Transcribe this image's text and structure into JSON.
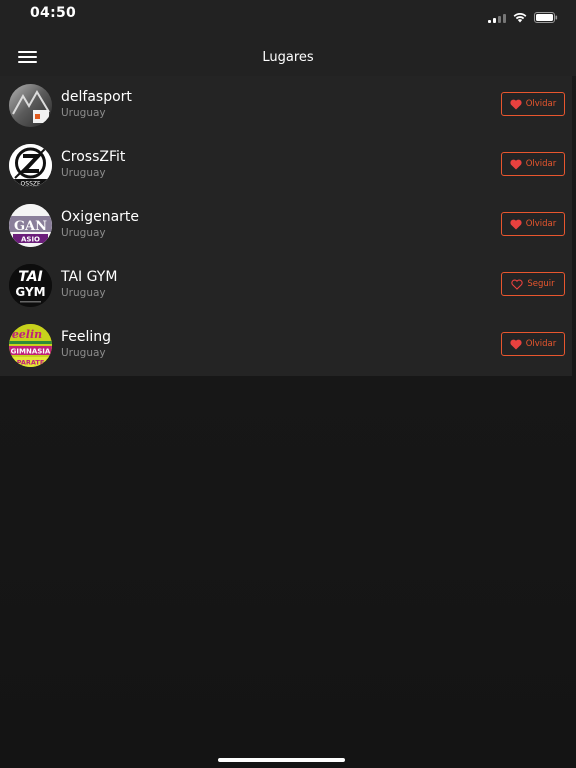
{
  "status_bar": {
    "time": "04:50"
  },
  "header": {
    "title": "Lugares"
  },
  "places": [
    {
      "name": "delfasport",
      "location": "Uruguay",
      "action": "Olvidar",
      "followed": true,
      "avatar": "delfasport-logo"
    },
    {
      "name": "CrossZFit",
      "location": "Uruguay",
      "action": "Olvidar",
      "followed": true,
      "avatar": "crosszfit-logo"
    },
    {
      "name": "Oxigenarte",
      "location": "Uruguay",
      "action": "Olvidar",
      "followed": true,
      "avatar": "oxigenarte-logo"
    },
    {
      "name": "TAI GYM",
      "location": "Uruguay",
      "action": "Seguir",
      "followed": false,
      "avatar": "tai-gym-logo"
    },
    {
      "name": "Feeling",
      "location": "Uruguay",
      "action": "Olvidar",
      "followed": true,
      "avatar": "feeling-logo"
    }
  ],
  "colors": {
    "accent": "#e8562e",
    "heart": "#e8413f",
    "background": "#161616",
    "list_background": "#242424",
    "topbar": "#222222"
  },
  "icons": [
    "menu-icon",
    "signal-icon",
    "wifi-icon",
    "battery-icon",
    "heart-filled-icon",
    "heart-outline-icon"
  ]
}
